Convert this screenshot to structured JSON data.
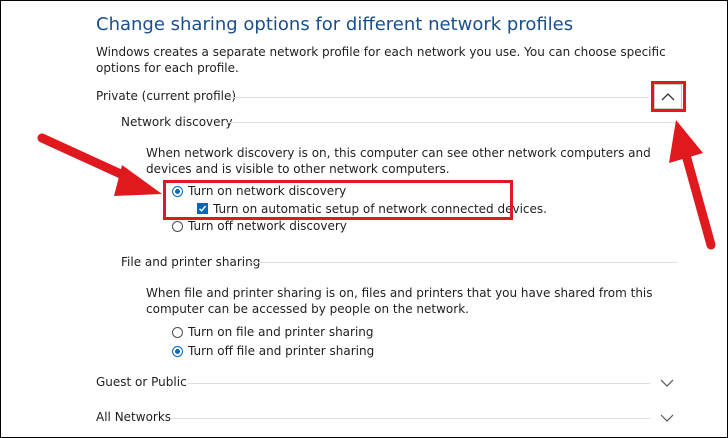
{
  "header": {
    "title": "Change sharing options for different network profiles",
    "description": "Windows creates a separate network profile for each network you use. You can choose specific options for each profile."
  },
  "private": {
    "label": "Private (current profile)",
    "network_discovery": {
      "heading": "Network discovery",
      "description": "When network discovery is on, this computer can see other network computers and devices and is visible to other network computers.",
      "turn_on_label": "Turn on network discovery",
      "turn_on_selected": true,
      "auto_setup_label": "Turn on automatic setup of network connected devices.",
      "auto_setup_checked": true,
      "turn_off_label": "Turn off network discovery"
    },
    "file_sharing": {
      "heading": "File and printer sharing",
      "description": "When file and printer sharing is on, files and printers that you have shared from this computer can be accessed by people on the network.",
      "turn_on_label": "Turn on file and printer sharing",
      "turn_off_label": "Turn off file and printer sharing",
      "turn_off_selected": true
    }
  },
  "guest": {
    "label": "Guest or Public"
  },
  "all_networks": {
    "label": "All Networks"
  },
  "annotation": {
    "color": "#e0191f"
  },
  "icons": {
    "collapse": "chevron-up-icon",
    "expand": "chevron-down-icon"
  }
}
